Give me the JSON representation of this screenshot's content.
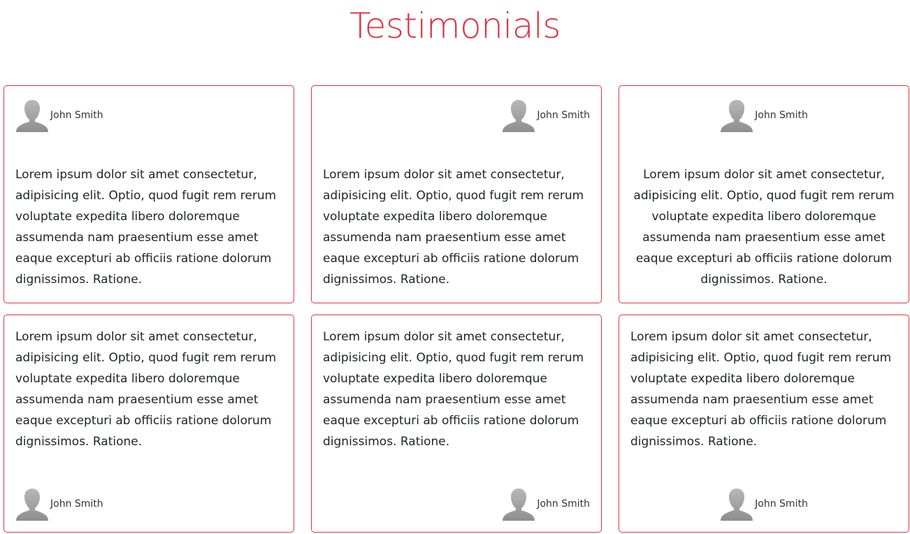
{
  "page": {
    "title": "Testimonials",
    "accent_color": "#dc3545"
  },
  "testimonials": [
    {
      "author": "John Smith",
      "avatar_icon": "user-silhouette-icon",
      "text": "Lorem ipsum dolor sit amet consectetur, adipisicing elit. Optio, quod fugit rem rerum voluptate expedita libero doloremque assumenda nam praesentium esse amet eaque excepturi ab officiis ratione dolorum dignissimos. Ratione."
    },
    {
      "author": "John Smith",
      "avatar_icon": "user-silhouette-icon",
      "text": "Lorem ipsum dolor sit amet consectetur, adipisicing elit. Optio, quod fugit rem rerum voluptate expedita libero doloremque assumenda nam praesentium esse amet eaque excepturi ab officiis ratione dolorum dignissimos. Ratione."
    },
    {
      "author": "John Smith",
      "avatar_icon": "user-silhouette-icon",
      "text": "Lorem ipsum dolor sit amet consectetur, adipisicing elit. Optio, quod fugit rem rerum voluptate expedita libero doloremque assumenda nam praesentium esse amet eaque excepturi ab officiis ratione dolorum dignissimos. Ratione."
    },
    {
      "author": "John Smith",
      "avatar_icon": "user-silhouette-icon",
      "text": "Lorem ipsum dolor sit amet consectetur, adipisicing elit. Optio, quod fugit rem rerum voluptate expedita libero doloremque assumenda nam praesentium esse amet eaque excepturi ab officiis ratione dolorum dignissimos. Ratione."
    },
    {
      "author": "John Smith",
      "avatar_icon": "user-silhouette-icon",
      "text": "Lorem ipsum dolor sit amet consectetur, adipisicing elit. Optio, quod fugit rem rerum voluptate expedita libero doloremque assumenda nam praesentium esse amet eaque excepturi ab officiis ratione dolorum dignissimos. Ratione."
    },
    {
      "author": "John Smith",
      "avatar_icon": "user-silhouette-icon",
      "text": "Lorem ipsum dolor sit amet consectetur, adipisicing elit. Optio, quod fugit rem rerum voluptate expedita libero doloremque assumenda nam praesentium esse amet eaque excepturi ab officiis ratione dolorum dignissimos. Ratione."
    }
  ]
}
